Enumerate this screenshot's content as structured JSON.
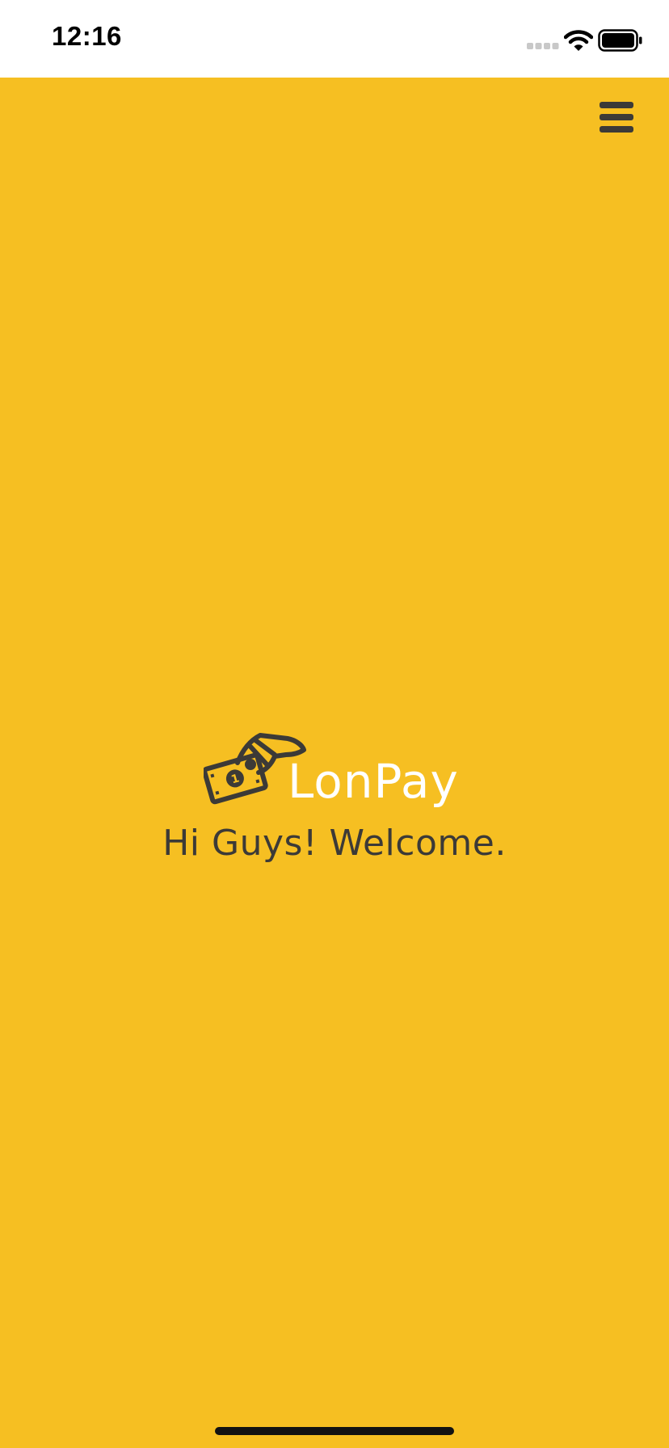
{
  "status_bar": {
    "time": "12:16"
  },
  "header": {
    "menu_icon": "hamburger-menu-icon"
  },
  "brand": {
    "logo_icon": "hand-with-money-icon",
    "name": "LonPay"
  },
  "welcome": {
    "text": "Hi Guys! Welcome."
  },
  "colors": {
    "background": "#f6bf22",
    "dark": "#3c3a37",
    "brand_text": "#ffffff"
  }
}
